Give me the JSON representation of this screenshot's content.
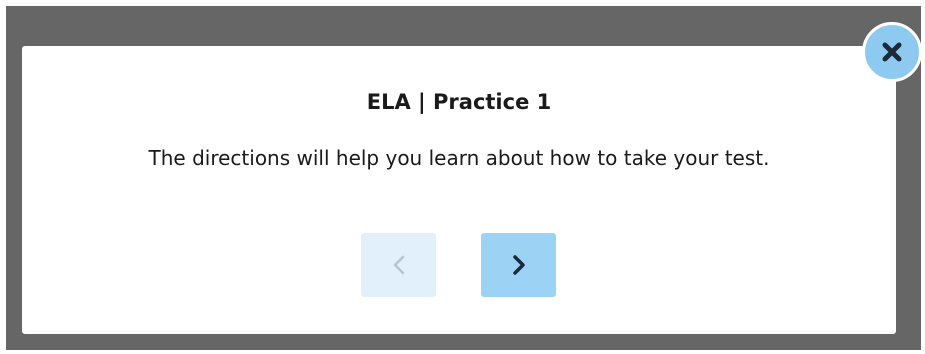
{
  "dialog": {
    "title": "ELA | Practice 1",
    "message": "The directions will help you learn about how to take your test."
  },
  "navigation": {
    "previous": {
      "icon": "chevron-left-icon",
      "state": "disabled"
    },
    "next": {
      "icon": "chevron-right-icon",
      "state": "enabled"
    }
  },
  "close_button": {
    "icon": "close-icon"
  },
  "colors": {
    "overlay": "#666666",
    "dialog_background": "#ffffff",
    "text": "#1a1a1a",
    "next_button": "#9cd3f5",
    "previous_button_disabled": "#e1f0fb",
    "close_button": "#8ec9ef",
    "icon_dark": "#1b2a3a",
    "icon_disabled": "#b8c4cc"
  }
}
